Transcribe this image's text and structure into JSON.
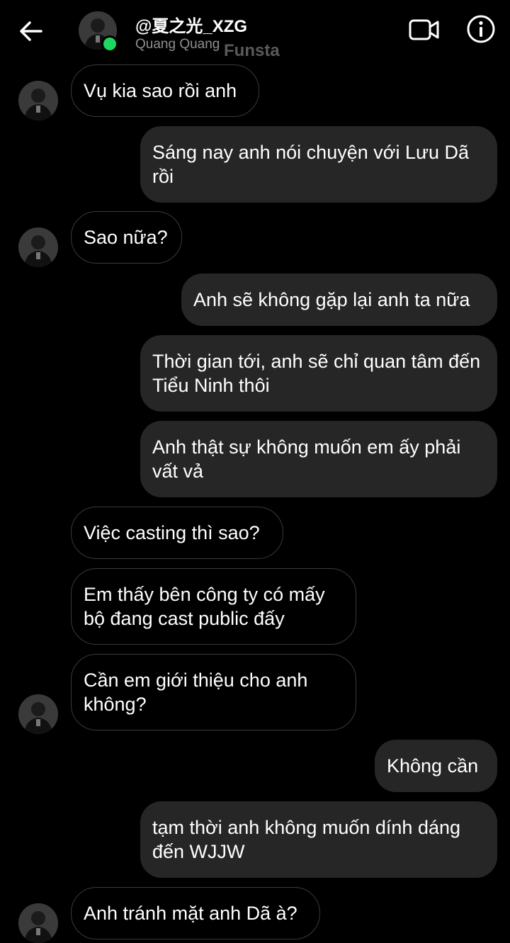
{
  "header": {
    "back_icon": "arrow-left-icon",
    "name": "@夏之光_XZG",
    "subtitle": "Quang Quang",
    "watermark": "Funsta",
    "video_icon": "video-call-icon",
    "info_icon": "info-icon",
    "online_color": "#1ed760"
  },
  "messages": [
    {
      "side": "in",
      "text": "Vụ kia sao rồi anh"
    },
    {
      "side": "out",
      "text": "Sáng nay anh nói chuyện với Lưu Dã rồi"
    },
    {
      "side": "in",
      "text": "Sao nữa?"
    },
    {
      "side": "out",
      "text": "Anh sẽ không gặp lại anh ta nữa"
    },
    {
      "side": "out",
      "text": "Thời gian tới, anh sẽ chỉ quan tâm đến Tiểu Ninh thôi"
    },
    {
      "side": "out",
      "text": "Anh thật sự không muốn em ấy phải vất vả"
    },
    {
      "side": "in",
      "text": "Việc casting thì sao?"
    },
    {
      "side": "in",
      "text": "Em thấy bên công ty có mấy bộ đang cast public đấy"
    },
    {
      "side": "in",
      "text": "Cần em giới thiệu cho anh không?"
    },
    {
      "side": "out",
      "text": "Không cần"
    },
    {
      "side": "out",
      "text": "tạm thời anh không muốn dính dáng đến WJJW"
    },
    {
      "side": "in",
      "text": "Anh tránh mặt anh Dã à?"
    }
  ]
}
